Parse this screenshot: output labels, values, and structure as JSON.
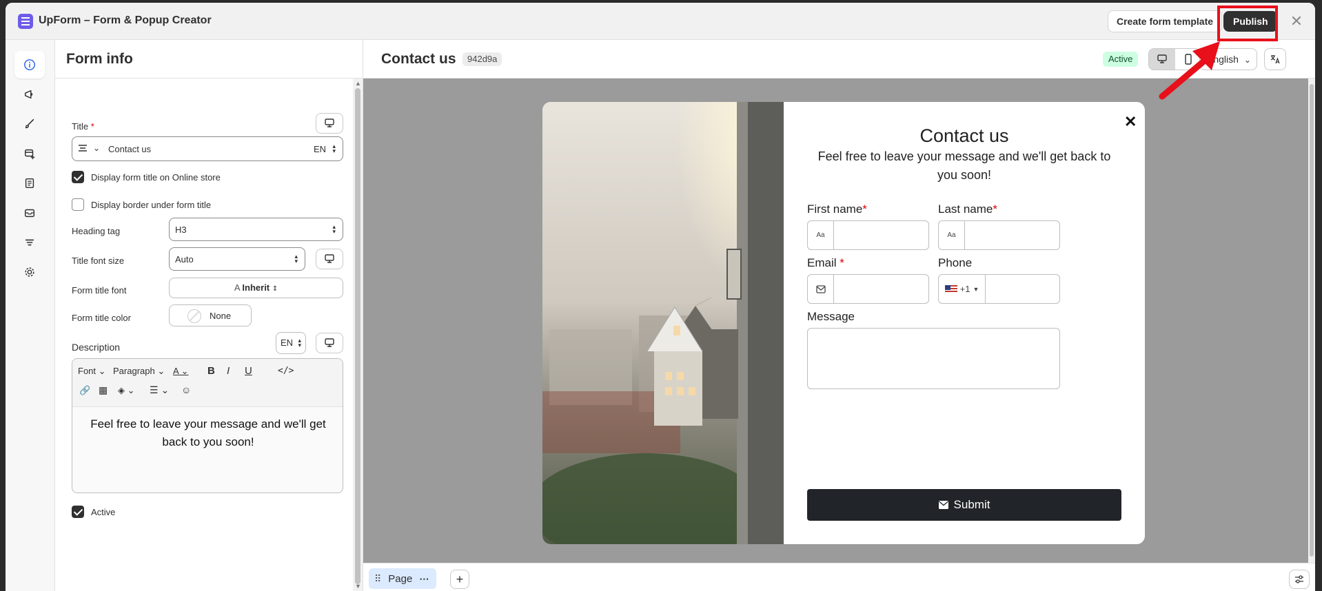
{
  "app": {
    "title": "UpForm – Form & Popup Creator"
  },
  "titlebar": {
    "create_template_label": "Create form template",
    "publish_label": "Publish",
    "close_icon": "close-icon"
  },
  "rail": {
    "items": [
      {
        "icon": "info-icon",
        "active": true
      },
      {
        "icon": "megaphone-icon",
        "active": false
      },
      {
        "icon": "brush-icon",
        "active": false
      },
      {
        "icon": "add-form-icon",
        "active": false
      },
      {
        "icon": "receipt-icon",
        "active": false
      },
      {
        "icon": "mail-icon",
        "active": false
      },
      {
        "icon": "filter-icon",
        "active": false
      },
      {
        "icon": "gear-icon",
        "active": false
      }
    ]
  },
  "panel": {
    "title": "Form info",
    "title_label": "Title",
    "title_required": "*",
    "title_value": "Contact us",
    "title_lang": "EN",
    "display_title_label": "Display form title on Online store",
    "display_title_checked": true,
    "display_border_label": "Display border under form title",
    "display_border_checked": false,
    "heading_tag_label": "Heading tag",
    "heading_tag_value": "H3",
    "title_font_size_label": "Title font size",
    "title_font_size_value": "Auto",
    "form_title_font_label": "Form title font",
    "form_title_font_value": "Inherit",
    "form_title_color_label": "Form title color",
    "form_title_color_value": "None",
    "description_label": "Description",
    "description_lang": "EN",
    "editor": {
      "font_label": "Font",
      "paragraph_label": "Paragraph",
      "content": "Feel free to leave your message and we'll get back to you soon!"
    },
    "active_label": "Active",
    "active_checked": true
  },
  "main": {
    "form_name": "Contact us",
    "form_id": "942d9a",
    "status": "Active",
    "language": "English"
  },
  "popup": {
    "title": "Contact us",
    "description": "Feel free to leave your message and we'll get back to you soon!",
    "fields": {
      "first_name": "First name",
      "last_name": "Last name",
      "email": "Email",
      "phone": "Phone",
      "message": "Message",
      "required_mark": "*"
    },
    "phone_code": "+1",
    "name_addon": "Aa",
    "submit_label": "Submit"
  },
  "pagebar": {
    "page_label": "Page",
    "add_label": "+"
  },
  "colors": {
    "accent": "#303030",
    "highlight": "#e8101a",
    "active_badge": "#cdfee1"
  }
}
